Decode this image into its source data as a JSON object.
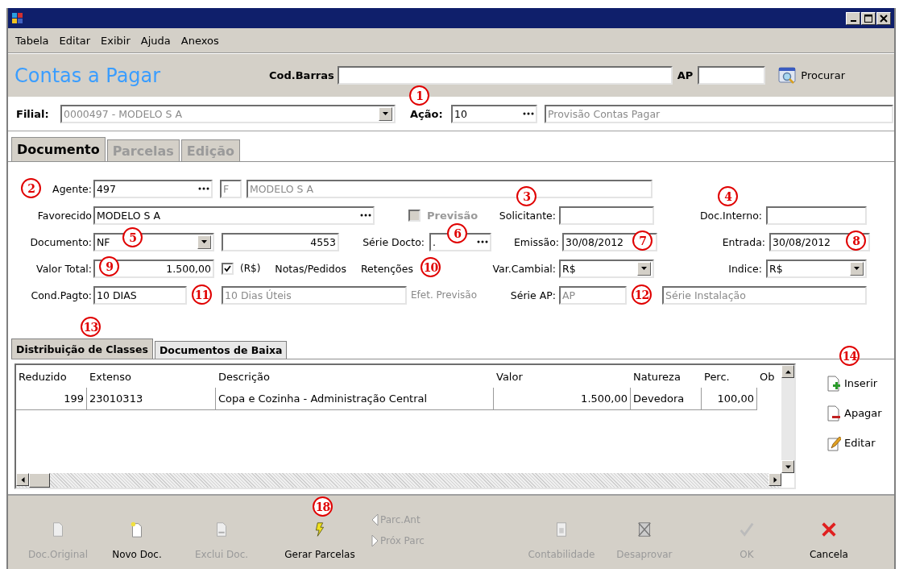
{
  "menu": [
    {
      "label": "Tabela"
    },
    {
      "label": "Editar"
    },
    {
      "label": "Exibir"
    },
    {
      "label": "Ajuda"
    },
    {
      "label": "Anexos"
    }
  ],
  "header": {
    "title": "Contas a Pagar",
    "barcode_label": "Cod.Barras",
    "ap_label": "AP",
    "search_button": "Procurar"
  },
  "filial": {
    "label": "Filial:",
    "value": "0000497 - MODELO S A"
  },
  "acao": {
    "label": "Ação:",
    "value": "10",
    "description": "Provisão Contas Pagar"
  },
  "tabs": [
    {
      "label": "Documento",
      "selected": true
    },
    {
      "label": "Parcelas",
      "selected": false
    },
    {
      "label": "Edição",
      "selected": false
    }
  ],
  "form": {
    "agente": {
      "label": "Agente:",
      "code": "497",
      "type": "F",
      "name": "MODELO S A"
    },
    "favorecido": {
      "label": "Favorecido",
      "value": "MODELO S A"
    },
    "previsao": {
      "label": "Previsão",
      "checked": false,
      "disabled": true
    },
    "solicitante": {
      "label": "Solicitante:"
    },
    "doc_interno": {
      "label": "Doc.Interno:"
    },
    "documento": {
      "label": "Documento:",
      "type": "NF",
      "number": "4553"
    },
    "serie_docto": {
      "label": "Série Docto:",
      "value": "."
    },
    "emissao": {
      "label": "Emissão:",
      "value": "30/08/2012"
    },
    "entrada": {
      "label": "Entrada:",
      "value": "30/08/2012"
    },
    "valor_total": {
      "label": "Valor Total:",
      "value": "1.500,00"
    },
    "currency": {
      "label": "(R$)",
      "checked": true
    },
    "links": [
      "Notas/Pedidos",
      "Retenções"
    ],
    "var_cambial": {
      "label": "Var.Cambial:",
      "value": "R$"
    },
    "indice": {
      "label": "Indice:",
      "value": "R$"
    },
    "cond_pagto": {
      "label": "Cond.Pagto:",
      "code": "10 DIAS",
      "description": "10 Dias Úteis"
    },
    "efet_previsao": "Efet. Previsão",
    "serie_ap": {
      "label": "Série AP:",
      "value": "AP"
    },
    "serie_instalacao": {
      "value": "Série Instalação"
    }
  },
  "callouts": [
    "1",
    "2",
    "3",
    "4",
    "5",
    "6",
    "7",
    "8",
    "9",
    "10",
    "11",
    "12",
    "13",
    "14",
    "18"
  ],
  "lower_tabs": [
    {
      "label": "Distribuição de Classes",
      "selected": true
    },
    {
      "label": "Documentos de Baixa",
      "selected": false
    }
  ],
  "table": {
    "columns": [
      "Reduzido",
      "Extenso",
      "Descrição",
      "Valor",
      "Natureza",
      "Perc.",
      "Ob"
    ],
    "rows": [
      {
        "cells": [
          "199",
          "23010313",
          "Copa e Cozinha - Administração Central",
          "1.500,00",
          "Devedora",
          "100,00"
        ]
      }
    ]
  },
  "side_buttons": [
    "Inserir",
    "Apagar",
    "Editar"
  ],
  "toolbar": [
    {
      "kind": "large",
      "label": "Doc.Original",
      "disabled": true
    },
    {
      "kind": "large",
      "label": "Novo Doc.",
      "disabled": false
    },
    {
      "kind": "large",
      "label": "Exclui Doc.",
      "disabled": true
    },
    {
      "kind": "large",
      "label": "Gerar Parcelas",
      "disabled": false
    },
    {
      "kind": "small",
      "label": "Parc.Ant",
      "disabled": true
    },
    {
      "kind": "small",
      "label": "Próx Parc",
      "disabled": true
    },
    {
      "kind": "large",
      "label": "Contabilidade",
      "disabled": true
    },
    {
      "kind": "large",
      "label": "Desaprovar",
      "disabled": true
    },
    {
      "kind": "large",
      "label": "OK",
      "disabled": true
    },
    {
      "kind": "large",
      "label": "Cancela",
      "disabled": false
    }
  ]
}
